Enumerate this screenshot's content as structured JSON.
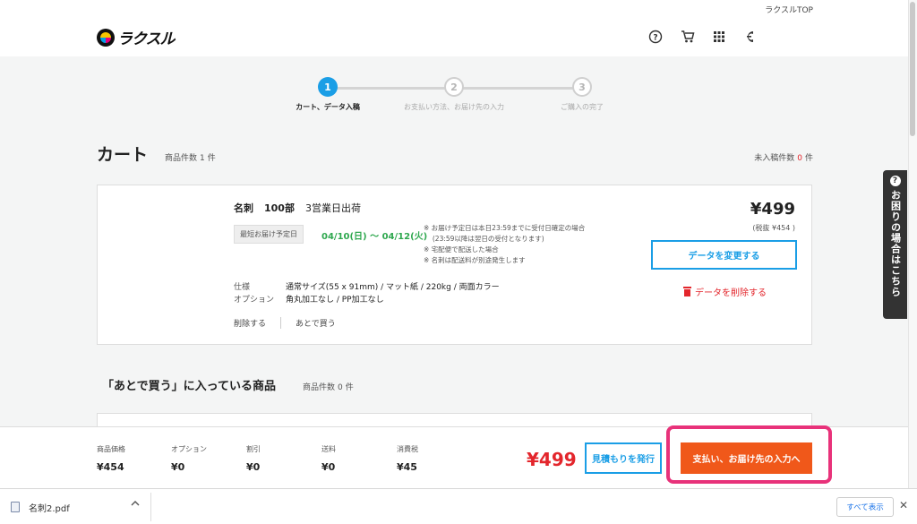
{
  "top_link": "ラクスルTOP",
  "logo_text": "ラクスル",
  "header_icons": [
    "help-circle-icon",
    "cart-icon",
    "apps-grid-icon",
    "account-icon"
  ],
  "stepper": [
    {
      "num": "1",
      "label": "カート、データ入稿",
      "state": "active"
    },
    {
      "num": "2",
      "label": "お支払い方法、お届け先の入力",
      "state": "inactive"
    },
    {
      "num": "3",
      "label": "ご購入の完了",
      "state": "inactive"
    }
  ],
  "cart": {
    "title": "カート",
    "count_label": "商品件数",
    "count": "1",
    "count_unit": "件",
    "unentered_label": "未入稿件数",
    "unentered_count": "0",
    "unentered_unit": "件"
  },
  "item": {
    "product": "名刺",
    "quantity": "100部",
    "shipping": "3営業日出荷",
    "delivery_tag": "最短お届け予定日",
    "delivery_date": "04/10(日) 〜 04/12(火)",
    "notes": [
      "※ お届け予定日は本日23:59までに受付日確定の場合",
      "　 (23:59以降は翌日の受付となります)",
      "※ 宅配便で配送した場合",
      "※ 名刺は配送料が別途発生します"
    ],
    "spec_label": "仕様",
    "spec_value": "通常サイズ(55 x 91mm) / マット紙 / 220kg / 両面カラー",
    "option_label": "オプション",
    "option_value": "角丸加工なし / PP加工なし",
    "delete_label": "削除する",
    "later_label": "あとで買う",
    "price": "¥499",
    "price_tax": "(税抜 ¥454 )",
    "change_data_button": "データを変更する",
    "delete_data_link": "データを削除する"
  },
  "later": {
    "title": "「あとで買う」に入っている商品",
    "count_label": "商品件数",
    "count": "0",
    "count_unit": "件"
  },
  "help_tab": "お困りの場合はこちら",
  "summary": {
    "items": [
      {
        "label": "商品価格",
        "value": "¥454"
      },
      {
        "label": "オプション",
        "value": "¥0"
      },
      {
        "label": "割引",
        "value": "¥0"
      },
      {
        "label": "送料",
        "value": "¥0"
      },
      {
        "label": "消費税",
        "value": "¥45"
      }
    ],
    "total": "¥499",
    "quote_button": "見積もりを発行",
    "pay_button": "支払い、お届け先の入力へ"
  },
  "download_bar": {
    "file_name": "名刺2.pdf",
    "show_all": "すべて表示",
    "close": "✕"
  },
  "colors": {
    "accent_blue": "#1a9ee6",
    "price_red": "#e3262c",
    "cta_orange": "#f0581a",
    "highlight_pink": "#e8327a",
    "delivery_green": "#2fa84f"
  }
}
